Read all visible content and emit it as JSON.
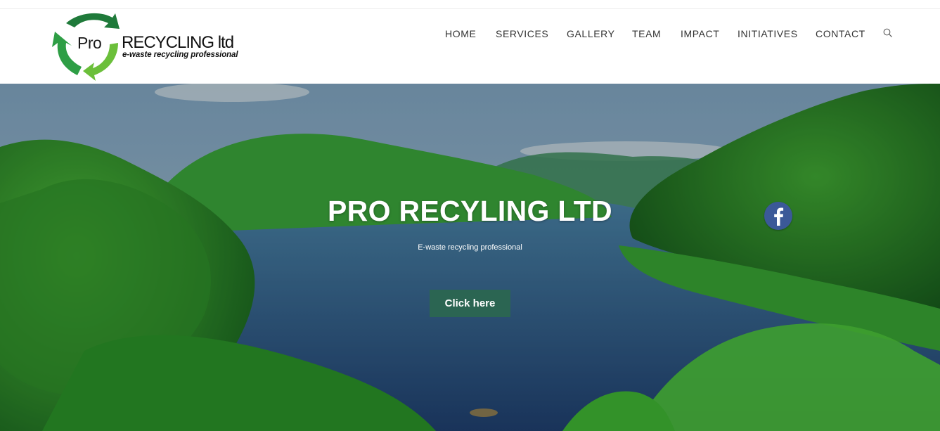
{
  "brand": {
    "logo_pro": "Pro",
    "logo_name": "RECYCLING ltd",
    "logo_tagline": "e-waste recycling professional"
  },
  "nav": {
    "items": [
      {
        "label": "HOME"
      },
      {
        "label": "SERVICES"
      },
      {
        "label": "GALLERY"
      },
      {
        "label": "TEAM"
      },
      {
        "label": "IMPACT"
      },
      {
        "label": "INITIATIVES"
      },
      {
        "label": "CONTACT"
      }
    ],
    "search_icon": "search-icon"
  },
  "hero": {
    "title": "PRO RECYLING LTD",
    "subtitle": "E-waste recycling professional",
    "button_label": "Click here",
    "social_icon": "facebook-icon"
  },
  "colors": {
    "button_bg": "#2b6552",
    "facebook": "#3b5998",
    "logo_green_dark": "#1f7a3a",
    "logo_green_light": "#4caf3c"
  }
}
